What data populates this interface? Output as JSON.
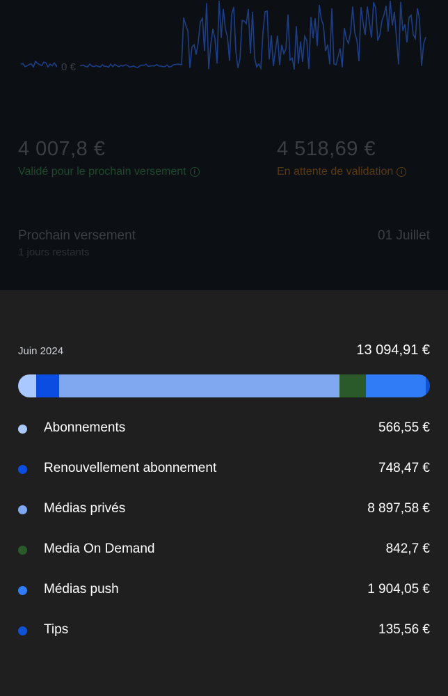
{
  "overview": {
    "chart_zero_label": "0 €",
    "validated_amount": "4 007,8 €",
    "validated_label": "Validé pour le prochain versement",
    "pending_amount": "4 518,69 €",
    "pending_label": "En attente de validation",
    "next_payout_title": "Prochain versement",
    "next_payout_remaining": "1 jours restants",
    "next_payout_date": "01 Juillet",
    "validated_color": "#1d4a2a",
    "pending_color": "#5a3a12",
    "sparkline_color": "#1d3e86"
  },
  "breakdown": {
    "month": "Juin 2024",
    "total": "13 094,91 €"
  },
  "chart_data": {
    "type": "bar",
    "categories": [
      "Abonnements",
      "Renouvellement abonnement",
      "Médias privés",
      "Media On Demand",
      "Médias push",
      "Tips"
    ],
    "values": [
      566.55,
      748.47,
      8897.58,
      842.7,
      1904.05,
      135.56
    ],
    "colors": [
      "#a9c8ff",
      "#0b4de0",
      "#7fa8f0",
      "#2a5a2a",
      "#2f7cf6",
      "#0f52d4"
    ]
  },
  "legend": [
    {
      "label": "Abonnements",
      "value": "566,55 €",
      "color": "#a9c8ff"
    },
    {
      "label": "Renouvellement abonnement",
      "value": "748,47 €",
      "color": "#0b4de0"
    },
    {
      "label": "Médias privés",
      "value": "8 897,58 €",
      "color": "#7fa8f0"
    },
    {
      "label": "Media On Demand",
      "value": "842,7 €",
      "color": "#2a5a2a"
    },
    {
      "label": "Médias push",
      "value": "1 904,05 €",
      "color": "#2f7cf6"
    },
    {
      "label": "Tips",
      "value": "135,56 €",
      "color": "#0f52d4"
    }
  ]
}
